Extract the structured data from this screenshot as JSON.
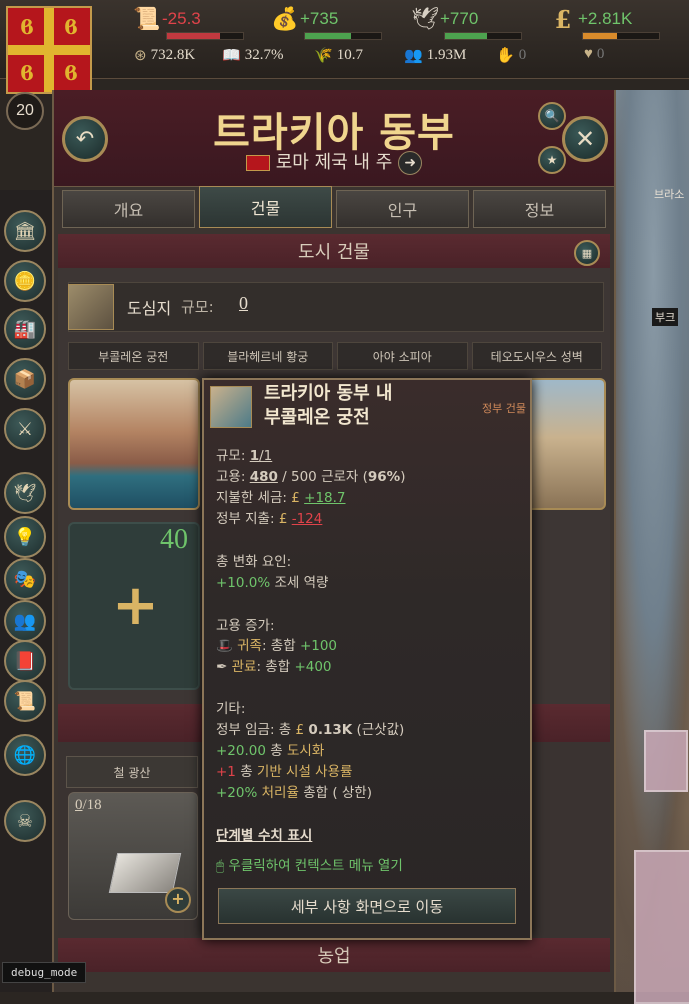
{
  "topbar": {
    "resources": [
      {
        "icon": "scroll-icon",
        "value": "-25.3",
        "tone": "negative"
      },
      {
        "icon": "money-bag-icon",
        "value": "+735",
        "tone": "positive"
      },
      {
        "icon": "dove-icon",
        "value": "+770",
        "tone": "positive"
      },
      {
        "icon": "pound-icon",
        "value": "+2.81K",
        "tone": "positive"
      }
    ],
    "stats": [
      {
        "icon": "treasury-icon",
        "value": "732.8K"
      },
      {
        "icon": "book-icon",
        "value": "32.7%"
      },
      {
        "icon": "wheat-icon",
        "value": "10.7"
      },
      {
        "icon": "people-icon",
        "value": "1.93M"
      },
      {
        "icon": "bow-icon",
        "value": "0"
      },
      {
        "icon": "heart-icon",
        "value": "0"
      }
    ],
    "rank": "20"
  },
  "panel": {
    "title": "트라키아 동부",
    "subtitle": "로마 제국 내 주",
    "tabs": [
      "개요",
      "건물",
      "인구",
      "정보"
    ],
    "active_tab": 1,
    "city_buildings_header": "도시 건물",
    "capital_label": "도심지",
    "scale_label": "규모:",
    "scale_value": "0",
    "building_tabs": [
      "부콜레온 궁전",
      "블라헤르네 황궁",
      "아야 소피아",
      "테오도시우스 성벽"
    ],
    "slot_count": "40",
    "slot_add": "+",
    "iron_mine_label": "철 광산",
    "iron_count": "0",
    "iron_max": "/18",
    "farm_header": "농업"
  },
  "tooltip": {
    "title_line1": "트라키아 동부 내",
    "title_line2": "부콜레온 궁전",
    "tag": "정부 건물",
    "scale_label": "규모:",
    "scale_value": "1",
    "scale_max": "/1",
    "employment_label": "고용:",
    "employment_value": "480",
    "employment_rest": " / 500 근로자 (",
    "employment_pct": "96%",
    "employment_close": ")",
    "tax_label": "지불한 세금:",
    "tax_value": "+18.7",
    "gov_spend_label": "정부 지출:",
    "gov_spend_value": "-124",
    "mods_header": "총 변화 요인:",
    "mod1_value": "+10.0%",
    "mod1_text": "조세 역량",
    "employ_header": "고용 증가:",
    "employ1_name": "귀족",
    "employ1_text": ": 총합",
    "employ1_value": "+100",
    "employ2_name": "관료",
    "employ2_text": ": 총합",
    "employ2_value": "+400",
    "other_header": "기타:",
    "wage_label": "정부 임금: 총",
    "wage_value": "0.13K",
    "wage_note": "(근삿값)",
    "urban_value": "+20.00",
    "urban_text_a": "총",
    "urban_text_b": "도시화",
    "infra_value": "+1",
    "infra_text_a": "총",
    "infra_text_b": "기반 시설 사용률",
    "proc_value": "+20%",
    "proc_text_a": "처리율",
    "proc_text_b": "총합 ( 상한)",
    "tier_link": "단계별 수치 표시",
    "right_click_hint": "우클릭하여 컨텍스트 메뉴 열기",
    "detail_button": "세부 사항 화면으로 이동"
  },
  "map": {
    "labels": [
      "브라소",
      "부크"
    ]
  },
  "debug_label": "debug_mode",
  "colors": {
    "positive": "#6fc46b",
    "negative": "#e0434a",
    "accent_gold": "#d9b464",
    "header_maroon": "#4a1d25"
  }
}
